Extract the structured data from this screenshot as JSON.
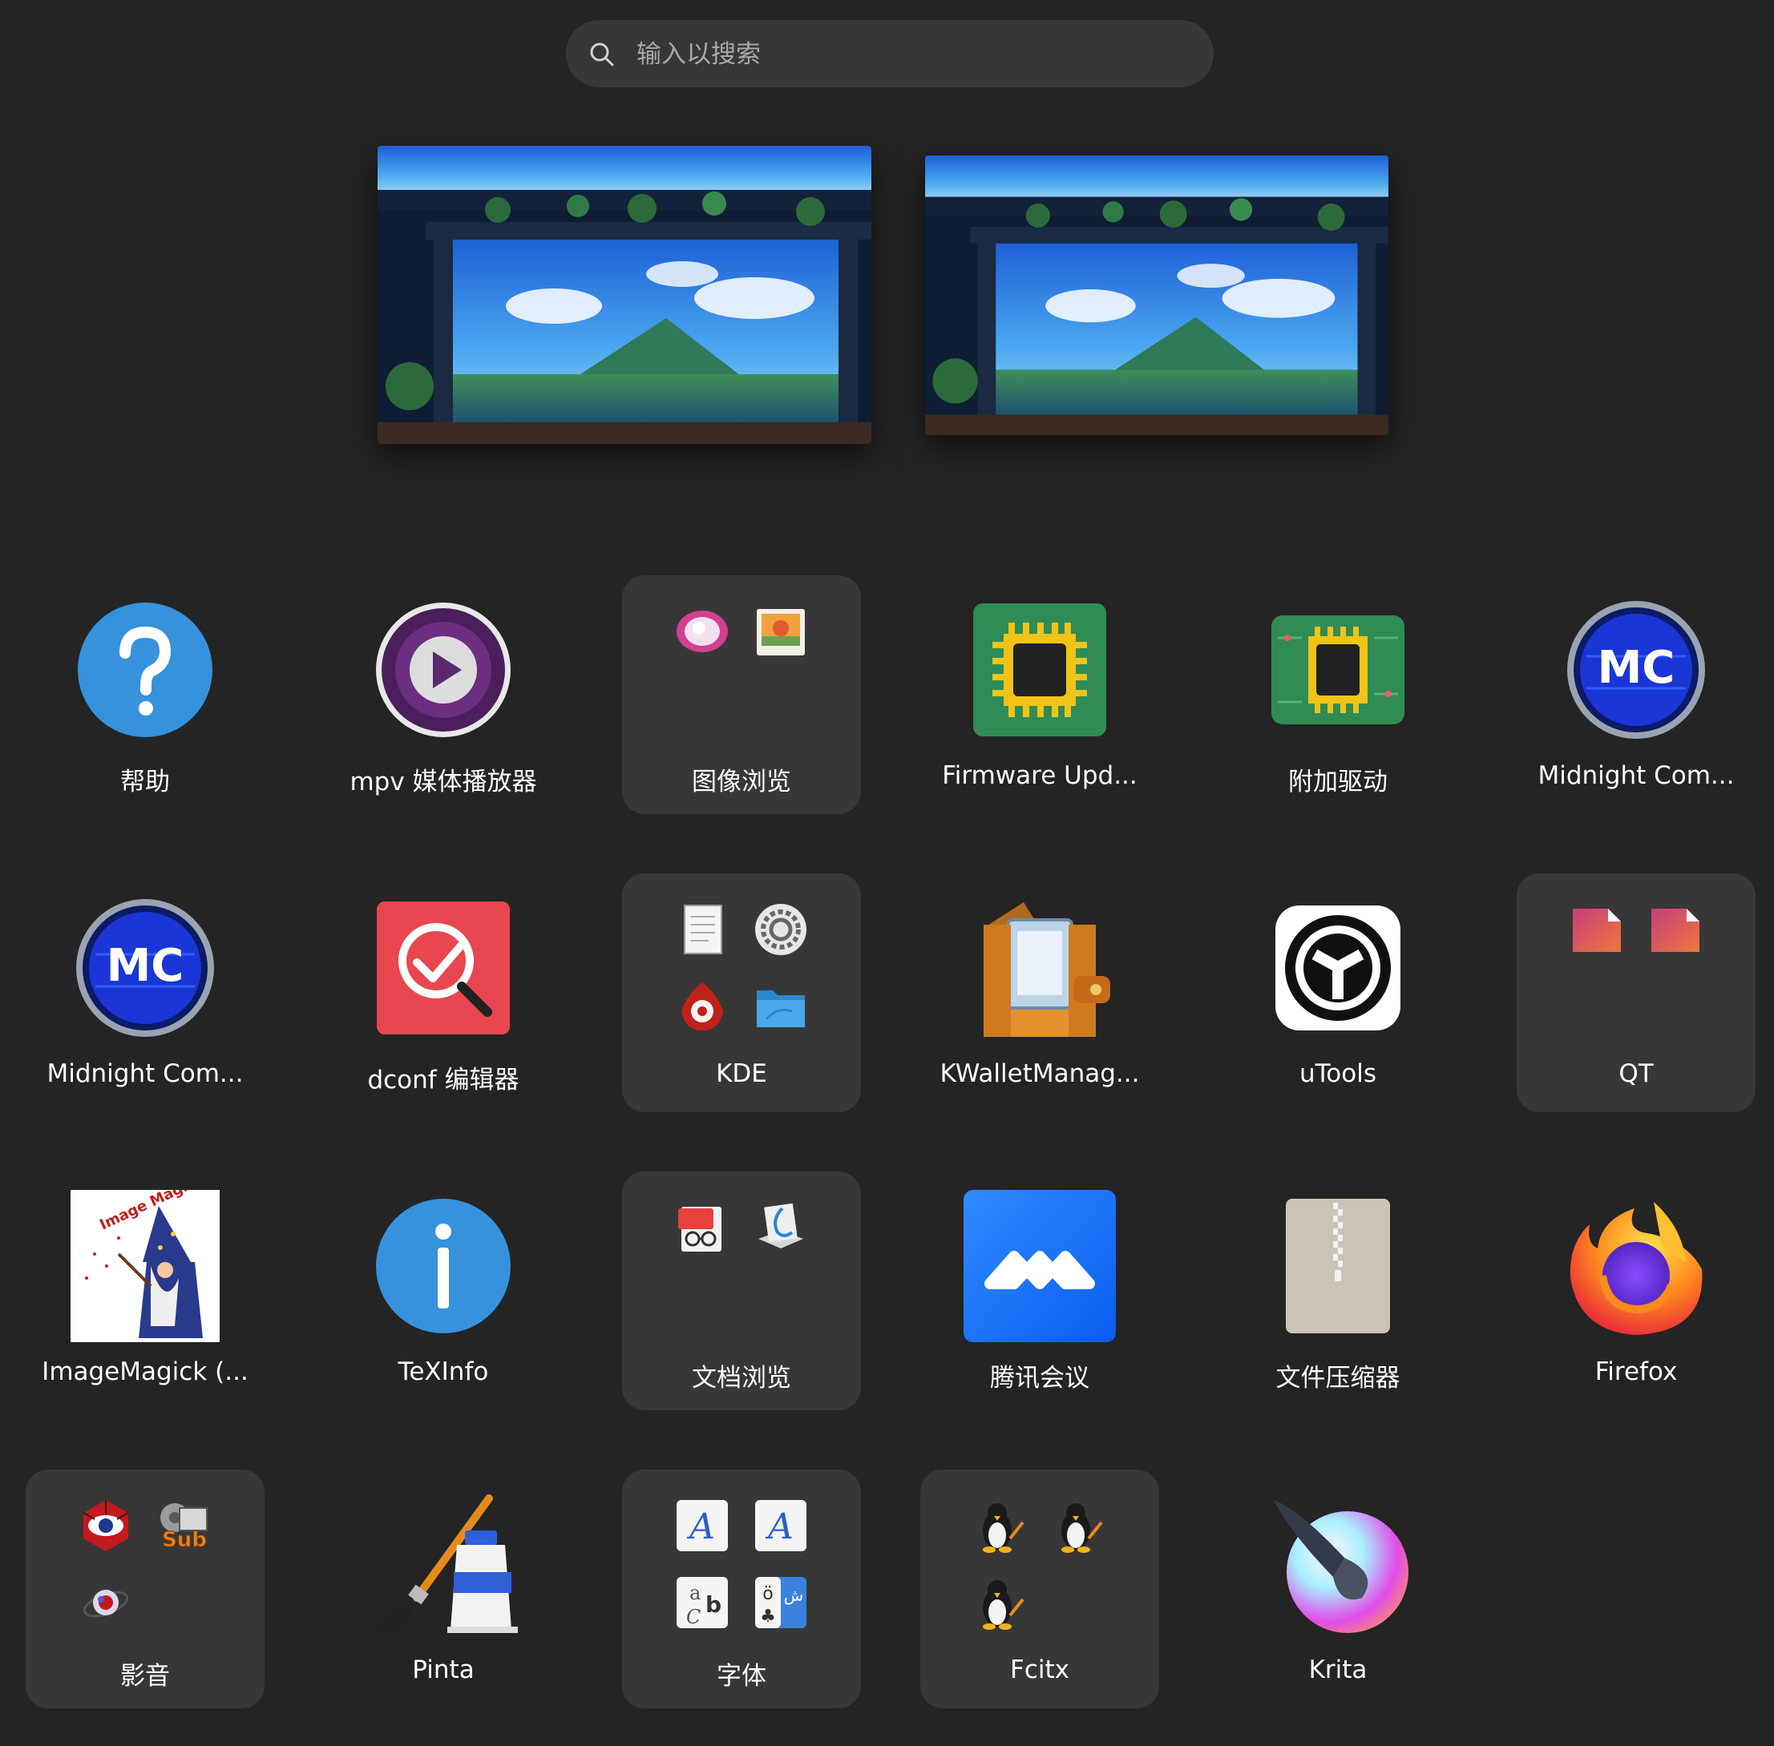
{
  "search": {
    "placeholder": "输入以搜索"
  },
  "workspaces": [
    {
      "label": ""
    },
    {
      "label": ""
    }
  ],
  "apps": {
    "help": "帮助",
    "mpv": "mpv 媒体播放器",
    "image_viewer": "图像浏览",
    "firmware": "Firmware Upd...",
    "drivers": "附加驱动",
    "mc1": "Midnight Com...",
    "mc2": "Midnight Com...",
    "dconf": "dconf 编辑器",
    "kde": "KDE",
    "kwallet": "KWalletManag...",
    "utools": "uTools",
    "qt": "QT",
    "imagemagick": "ImageMagick (...",
    "texinfo": "TeXInfo",
    "doc_viewer": "文档浏览",
    "tencent_meeting": "腾讯会议",
    "archiver": "文件压缩器",
    "firefox": "Firefox",
    "av": "影音",
    "pinta": "Pinta",
    "fonts": "字体",
    "fcitx": "Fcitx",
    "krita": "Krita"
  },
  "icons": {
    "imagemagick_text": "Image Magick",
    "sub_text": "Sub",
    "mc_text": "MC"
  }
}
